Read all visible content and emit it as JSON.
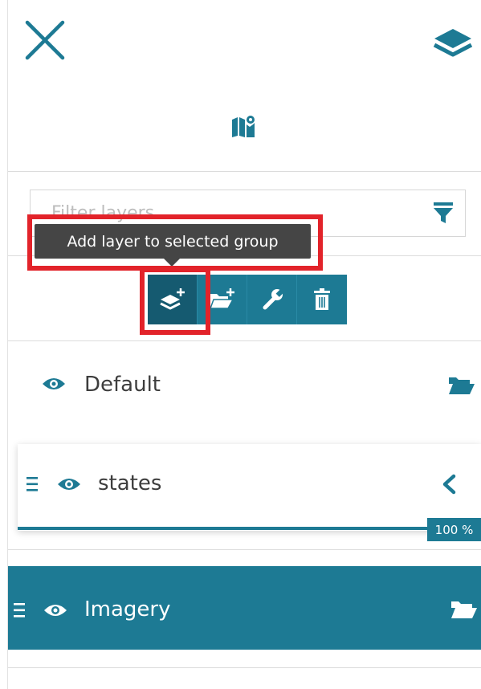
{
  "filter": {
    "placeholder": "Filter layers"
  },
  "tooltip": {
    "text": "Add layer to selected group"
  },
  "toolbar": {
    "buttons": [
      {
        "name": "add-layer",
        "icon": "layer-plus-icon",
        "active": true
      },
      {
        "name": "add-group",
        "icon": "folder-plus-icon",
        "active": false
      },
      {
        "name": "settings",
        "icon": "wrench-icon",
        "active": false
      },
      {
        "name": "delete",
        "icon": "trash-icon",
        "active": false
      }
    ]
  },
  "groups": {
    "default": {
      "label": "Default"
    },
    "states": {
      "label": "states",
      "opacity_percent": 100,
      "opacity_text": "100 %"
    },
    "imagery": {
      "label": "Imagery"
    }
  },
  "colors": {
    "accent": "#1d7a94",
    "accent_dark": "#155a70",
    "highlight": "#e2232a"
  }
}
